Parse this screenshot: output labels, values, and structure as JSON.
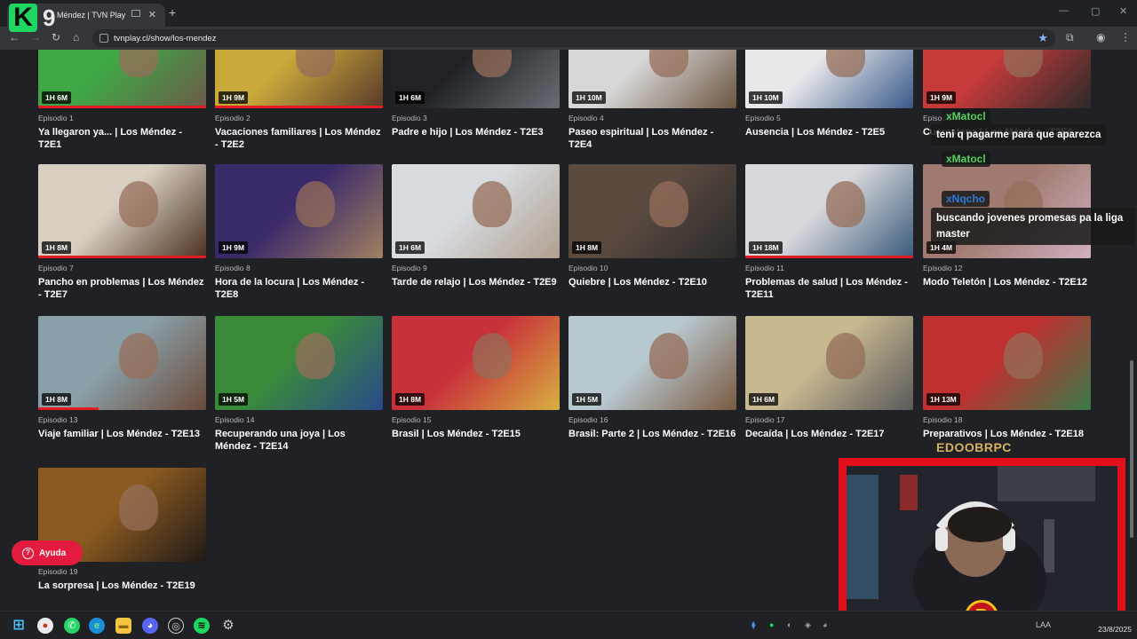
{
  "browser": {
    "tab_title": "Méndez | TVN Play",
    "url": "tvnplay.cl/show/los-mendez"
  },
  "overlay": {
    "logo_letter": "K",
    "logo_number": "9",
    "streamer_name": "EDOOBRPC"
  },
  "episodes": [
    {
      "label": "Episodio 1",
      "title": "Ya llegaron ya... | Los Méndez - T2E1",
      "duration": "1H 6M",
      "progress": 1.0
    },
    {
      "label": "Episodio 2",
      "title": "Vacaciones familiares | Los Méndez - T2E2",
      "duration": "1H 9M",
      "progress": 1.0
    },
    {
      "label": "Episodio 3",
      "title": "Padre e hijo | Los Méndez - T2E3",
      "duration": "1H 6M",
      "progress": 0
    },
    {
      "label": "Episodio 4",
      "title": "Paseo espiritual | Los Méndez - T2E4",
      "duration": "1H 10M",
      "progress": 0
    },
    {
      "label": "Episodio 5",
      "title": "Ausencia | Los Méndez - T2E5",
      "duration": "1H 10M",
      "progress": 0
    },
    {
      "label": "Episodio 6",
      "title": "Cuarentena | Los Méndez - T2E6",
      "duration": "1H 9M",
      "progress": 0
    },
    {
      "label": "Episodio 7",
      "title": "Pancho en problemas | Los Méndez - T2E7",
      "duration": "1H 8M",
      "progress": 1.0
    },
    {
      "label": "Episodio 8",
      "title": "Hora de la locura | Los Méndez - T2E8",
      "duration": "1H 9M",
      "progress": 0
    },
    {
      "label": "Episodio 9",
      "title": "Tarde de relajo | Los Méndez - T2E9",
      "duration": "1H 6M",
      "progress": 0
    },
    {
      "label": "Episodio 10",
      "title": "Quiebre | Los Méndez - T2E10",
      "duration": "1H 8M",
      "progress": 0
    },
    {
      "label": "Episodio 11",
      "title": "Problemas de salud | Los Méndez - T2E11",
      "duration": "1H 18M",
      "progress": 1.0
    },
    {
      "label": "Episodio 12",
      "title": "Modo Teletón | Los Méndez - T2E12",
      "duration": "1H 4M",
      "progress": 0
    },
    {
      "label": "Episodio 13",
      "title": "Viaje familiar | Los Méndez - T2E13",
      "duration": "1H 8M",
      "progress": 0.36
    },
    {
      "label": "Episodio 14",
      "title": "Recuperando una joya | Los Méndez - T2E14",
      "duration": "1H 5M",
      "progress": 0
    },
    {
      "label": "Episodio 15",
      "title": "Brasil | Los Méndez - T2E15",
      "duration": "1H 8M",
      "progress": 0
    },
    {
      "label": "Episodio 16",
      "title": "Brasil: Parte 2 | Los Méndez - T2E16",
      "duration": "1H 5M",
      "progress": 0
    },
    {
      "label": "Episodio 17",
      "title": "Decaída | Los Méndez - T2E17",
      "duration": "1H 6M",
      "progress": 0
    },
    {
      "label": "Episodio 18",
      "title": "Preparativos | Los Méndez - T2E18",
      "duration": "1H 13M",
      "progress": 0
    },
    {
      "label": "Episodio 19",
      "title": "La sorpresa | Los Méndez - T2E19",
      "duration": "",
      "progress": 0
    }
  ],
  "chat": [
    {
      "user": "xMatocl",
      "message": "teni q pagarme para que aparezca",
      "user_color": "#4fd35b"
    },
    {
      "user": "xMatocl",
      "message": "",
      "user_color": "#4fd35b"
    },
    {
      "user": "xNqcho",
      "message": "buscando jovenes promesas pa la liga master",
      "user_color": "#2f7bd9"
    }
  ],
  "help_button": "Ayuda",
  "taskbar": {
    "lang": "LAA",
    "date": "23/8/2025"
  },
  "colors": {
    "accent_red": "#e31b23",
    "background": "#1f2125"
  }
}
